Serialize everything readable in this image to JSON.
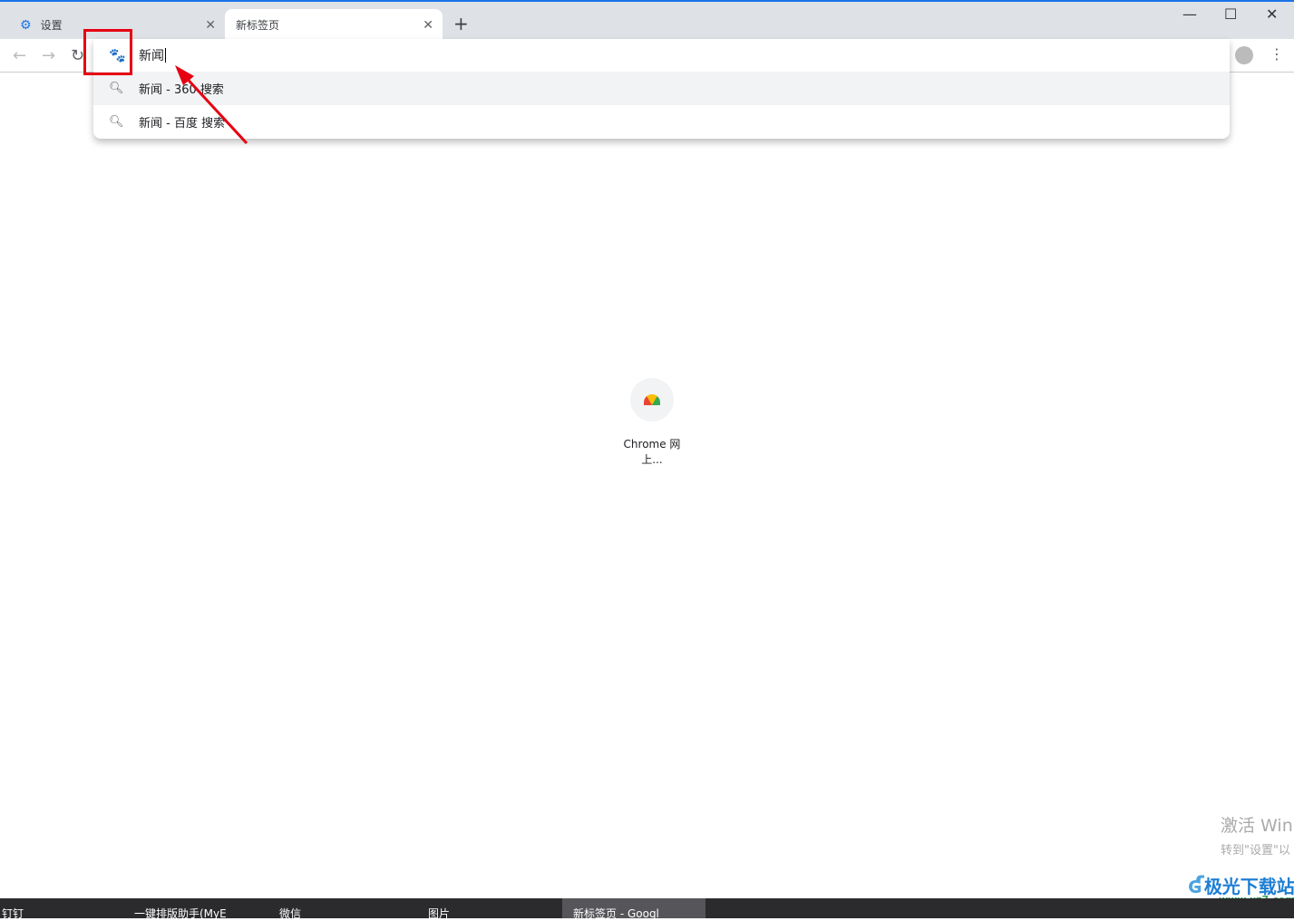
{
  "tabs": [
    {
      "label": "设置",
      "icon": "gear-icon"
    },
    {
      "label": "新标签页"
    }
  ],
  "window": {
    "minimize": "—",
    "maximize": "☐",
    "close": "✕"
  },
  "omnibox": {
    "value": "新闻",
    "engine_icon": "baidu-paw-icon"
  },
  "suggestions": [
    {
      "text": "新闻 - 360 搜索"
    },
    {
      "text": "新闻 - 百度 搜索"
    }
  ],
  "shortcut": {
    "label": "Chrome 网上..."
  },
  "watermark": {
    "line1": "激活 Win",
    "line2": "转到\"设置\"以"
  },
  "site_logo": {
    "name": "极光下载站",
    "url": "www.xz7.com"
  },
  "taskbar": [
    {
      "label": "钉钉"
    },
    {
      "label": "一键排版助手(MyE"
    },
    {
      "label": "微信"
    },
    {
      "label": "图片"
    },
    {
      "label": "新标签页 - Googl"
    }
  ],
  "colors": {
    "accent": "#1a73e8",
    "annotation": "#e60012",
    "baidu": "#2932e1"
  }
}
